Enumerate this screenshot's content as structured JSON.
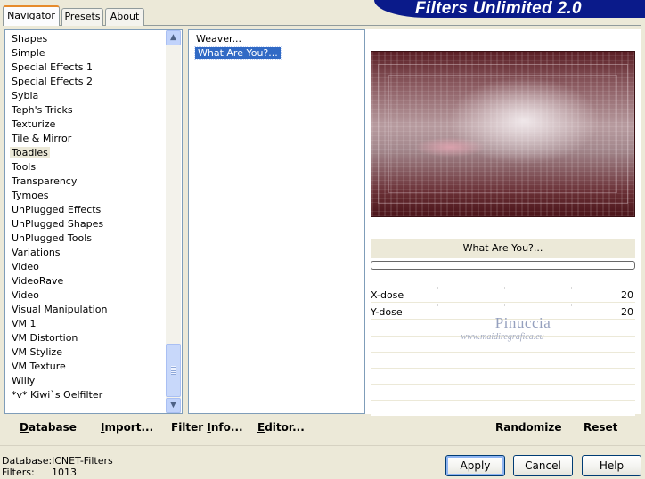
{
  "app": {
    "title": "Filters Unlimited 2.0"
  },
  "tabs": [
    {
      "label": "Navigator",
      "active": true
    },
    {
      "label": "Presets",
      "active": false
    },
    {
      "label": "About",
      "active": false
    }
  ],
  "categories": {
    "items": [
      "Shapes",
      "Simple",
      "Special Effects 1",
      "Special Effects 2",
      "Sybia",
      "Teph's Tricks",
      "Texturize",
      "Tile & Mirror",
      "Toadies",
      "Tools",
      "Transparency",
      "Tymoes",
      "UnPlugged Effects",
      "UnPlugged Shapes",
      "UnPlugged Tools",
      "Variations",
      "Video",
      "VideoRave",
      "Video",
      "Visual Manipulation",
      "VM 1",
      "VM Distortion",
      "VM Stylize",
      "VM Texture",
      "Willy",
      "*v* Kiwi`s Oelfilter"
    ],
    "selected_index": 8,
    "scroll_up_icon": "chevron-up-icon",
    "scroll_down_icon": "chevron-down-icon"
  },
  "filters": {
    "items": [
      "Weaver...",
      "What Are You?..."
    ],
    "selected_index": 1
  },
  "preview": {
    "filter_name": "What Are You?...",
    "progress_percent": 0,
    "colors": {
      "dark": "#4a1419",
      "mid": "#8a5a60",
      "light": "#f6f0f2"
    }
  },
  "params": [
    {
      "label": "X-dose",
      "value": "20"
    },
    {
      "label": "Y-dose",
      "value": "20"
    }
  ],
  "watermark": {
    "name": "Pinuccia",
    "url": "www.maidiregrafica.eu"
  },
  "toolbar": {
    "database": {
      "ul": "D",
      "rest": "atabase"
    },
    "import": {
      "ul": "I",
      "rest": "mport..."
    },
    "filter_info": {
      "pre": "Filter ",
      "ul": "I",
      "rest": "nfo..."
    },
    "editor": {
      "ul": "E",
      "rest": "ditor..."
    },
    "randomize": "Randomize",
    "reset": "Reset"
  },
  "status": {
    "database_label": "Database:",
    "database_value": "ICNET-Filters",
    "filters_label": "Filters:",
    "filters_value": "1013"
  },
  "buttons": {
    "apply": "Apply",
    "cancel": "Cancel",
    "help": "Help"
  },
  "colors": {
    "banner": "#0a1a8a",
    "selection": "#316ac5",
    "panel": "#ece9d8"
  }
}
